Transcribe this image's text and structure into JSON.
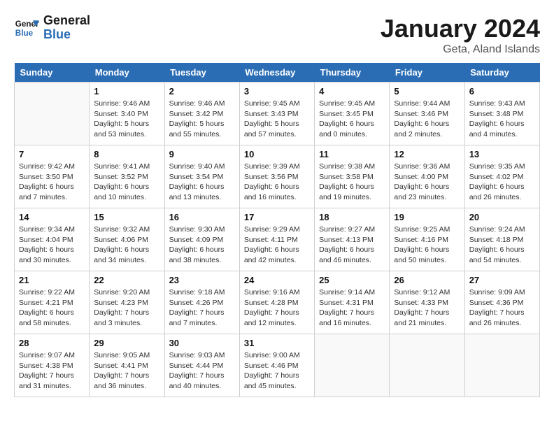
{
  "header": {
    "logo_line1": "General",
    "logo_line2": "Blue",
    "title": "January 2024",
    "subtitle": "Geta, Aland Islands"
  },
  "weekdays": [
    "Sunday",
    "Monday",
    "Tuesday",
    "Wednesday",
    "Thursday",
    "Friday",
    "Saturday"
  ],
  "weeks": [
    [
      {
        "day": "",
        "info": ""
      },
      {
        "day": "1",
        "info": "Sunrise: 9:46 AM\nSunset: 3:40 PM\nDaylight: 5 hours\nand 53 minutes."
      },
      {
        "day": "2",
        "info": "Sunrise: 9:46 AM\nSunset: 3:42 PM\nDaylight: 5 hours\nand 55 minutes."
      },
      {
        "day": "3",
        "info": "Sunrise: 9:45 AM\nSunset: 3:43 PM\nDaylight: 5 hours\nand 57 minutes."
      },
      {
        "day": "4",
        "info": "Sunrise: 9:45 AM\nSunset: 3:45 PM\nDaylight: 6 hours\nand 0 minutes."
      },
      {
        "day": "5",
        "info": "Sunrise: 9:44 AM\nSunset: 3:46 PM\nDaylight: 6 hours\nand 2 minutes."
      },
      {
        "day": "6",
        "info": "Sunrise: 9:43 AM\nSunset: 3:48 PM\nDaylight: 6 hours\nand 4 minutes."
      }
    ],
    [
      {
        "day": "7",
        "info": "Sunrise: 9:42 AM\nSunset: 3:50 PM\nDaylight: 6 hours\nand 7 minutes."
      },
      {
        "day": "8",
        "info": "Sunrise: 9:41 AM\nSunset: 3:52 PM\nDaylight: 6 hours\nand 10 minutes."
      },
      {
        "day": "9",
        "info": "Sunrise: 9:40 AM\nSunset: 3:54 PM\nDaylight: 6 hours\nand 13 minutes."
      },
      {
        "day": "10",
        "info": "Sunrise: 9:39 AM\nSunset: 3:56 PM\nDaylight: 6 hours\nand 16 minutes."
      },
      {
        "day": "11",
        "info": "Sunrise: 9:38 AM\nSunset: 3:58 PM\nDaylight: 6 hours\nand 19 minutes."
      },
      {
        "day": "12",
        "info": "Sunrise: 9:36 AM\nSunset: 4:00 PM\nDaylight: 6 hours\nand 23 minutes."
      },
      {
        "day": "13",
        "info": "Sunrise: 9:35 AM\nSunset: 4:02 PM\nDaylight: 6 hours\nand 26 minutes."
      }
    ],
    [
      {
        "day": "14",
        "info": "Sunrise: 9:34 AM\nSunset: 4:04 PM\nDaylight: 6 hours\nand 30 minutes."
      },
      {
        "day": "15",
        "info": "Sunrise: 9:32 AM\nSunset: 4:06 PM\nDaylight: 6 hours\nand 34 minutes."
      },
      {
        "day": "16",
        "info": "Sunrise: 9:30 AM\nSunset: 4:09 PM\nDaylight: 6 hours\nand 38 minutes."
      },
      {
        "day": "17",
        "info": "Sunrise: 9:29 AM\nSunset: 4:11 PM\nDaylight: 6 hours\nand 42 minutes."
      },
      {
        "day": "18",
        "info": "Sunrise: 9:27 AM\nSunset: 4:13 PM\nDaylight: 6 hours\nand 46 minutes."
      },
      {
        "day": "19",
        "info": "Sunrise: 9:25 AM\nSunset: 4:16 PM\nDaylight: 6 hours\nand 50 minutes."
      },
      {
        "day": "20",
        "info": "Sunrise: 9:24 AM\nSunset: 4:18 PM\nDaylight: 6 hours\nand 54 minutes."
      }
    ],
    [
      {
        "day": "21",
        "info": "Sunrise: 9:22 AM\nSunset: 4:21 PM\nDaylight: 6 hours\nand 58 minutes."
      },
      {
        "day": "22",
        "info": "Sunrise: 9:20 AM\nSunset: 4:23 PM\nDaylight: 7 hours\nand 3 minutes."
      },
      {
        "day": "23",
        "info": "Sunrise: 9:18 AM\nSunset: 4:26 PM\nDaylight: 7 hours\nand 7 minutes."
      },
      {
        "day": "24",
        "info": "Sunrise: 9:16 AM\nSunset: 4:28 PM\nDaylight: 7 hours\nand 12 minutes."
      },
      {
        "day": "25",
        "info": "Sunrise: 9:14 AM\nSunset: 4:31 PM\nDaylight: 7 hours\nand 16 minutes."
      },
      {
        "day": "26",
        "info": "Sunrise: 9:12 AM\nSunset: 4:33 PM\nDaylight: 7 hours\nand 21 minutes."
      },
      {
        "day": "27",
        "info": "Sunrise: 9:09 AM\nSunset: 4:36 PM\nDaylight: 7 hours\nand 26 minutes."
      }
    ],
    [
      {
        "day": "28",
        "info": "Sunrise: 9:07 AM\nSunset: 4:38 PM\nDaylight: 7 hours\nand 31 minutes."
      },
      {
        "day": "29",
        "info": "Sunrise: 9:05 AM\nSunset: 4:41 PM\nDaylight: 7 hours\nand 36 minutes."
      },
      {
        "day": "30",
        "info": "Sunrise: 9:03 AM\nSunset: 4:44 PM\nDaylight: 7 hours\nand 40 minutes."
      },
      {
        "day": "31",
        "info": "Sunrise: 9:00 AM\nSunset: 4:46 PM\nDaylight: 7 hours\nand 45 minutes."
      },
      {
        "day": "",
        "info": ""
      },
      {
        "day": "",
        "info": ""
      },
      {
        "day": "",
        "info": ""
      }
    ]
  ]
}
